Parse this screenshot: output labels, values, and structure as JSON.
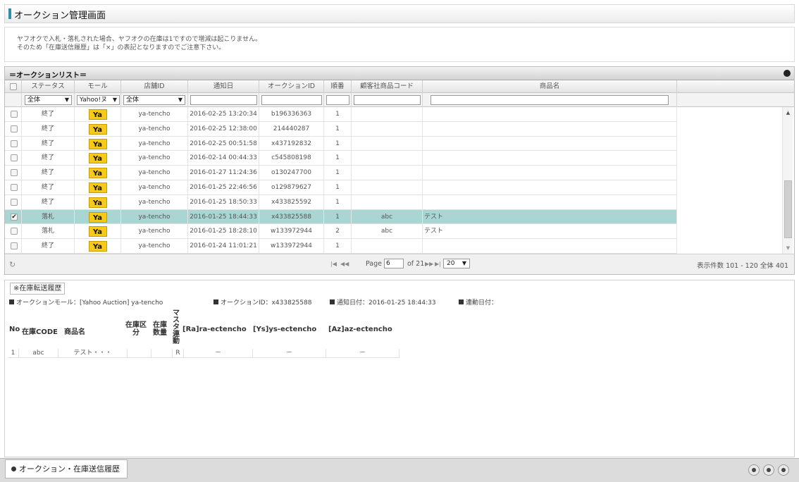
{
  "page": {
    "title": "オークション管理画面"
  },
  "notice": {
    "line1": "ヤフオクで入札・落札された場合、ヤフオクの在庫は1ですので増減は起こりません。",
    "line2": "そのため「在庫送信履歴」は「×」の表記となりますのでご注意下さい。"
  },
  "list": {
    "title": "＝オークションリスト＝",
    "columns": [
      "ステータス",
      "モール",
      "店舗ID",
      "通知日",
      "オークションID",
      "順番",
      "顧客社商品コード",
      "商品名"
    ],
    "filters": {
      "status": "全体",
      "mall": "Yahoo!ヌ",
      "store": "全体"
    },
    "rows": [
      {
        "checked": false,
        "status": "終了",
        "mall": "Ya",
        "store": "ya-tencho",
        "date": "2016-02-25 13:20:34",
        "auction_id": "b196336363",
        "order": "1",
        "code": "",
        "name": ""
      },
      {
        "checked": false,
        "status": "終了",
        "mall": "Ya",
        "store": "ya-tencho",
        "date": "2016-02-25 12:38:00",
        "auction_id": "214440287",
        "order": "1",
        "code": "",
        "name": ""
      },
      {
        "checked": false,
        "status": "終了",
        "mall": "Ya",
        "store": "ya-tencho",
        "date": "2016-02-25 00:51:58",
        "auction_id": "x437192832",
        "order": "1",
        "code": "",
        "name": ""
      },
      {
        "checked": false,
        "status": "終了",
        "mall": "Ya",
        "store": "ya-tencho",
        "date": "2016-02-14 00:44:33",
        "auction_id": "c545808198",
        "order": "1",
        "code": "",
        "name": ""
      },
      {
        "checked": false,
        "status": "終了",
        "mall": "Ya",
        "store": "ya-tencho",
        "date": "2016-01-27 11:24:36",
        "auction_id": "o130247700",
        "order": "1",
        "code": "",
        "name": ""
      },
      {
        "checked": false,
        "status": "終了",
        "mall": "Ya",
        "store": "ya-tencho",
        "date": "2016-01-25 22:46:56",
        "auction_id": "o129879627",
        "order": "1",
        "code": "",
        "name": ""
      },
      {
        "checked": false,
        "status": "終了",
        "mall": "Ya",
        "store": "ya-tencho",
        "date": "2016-01-25 18:50:33",
        "auction_id": "x433825592",
        "order": "1",
        "code": "",
        "name": ""
      },
      {
        "checked": true,
        "status": "落札",
        "mall": "Ya",
        "store": "ya-tencho",
        "date": "2016-01-25 18:44:33",
        "auction_id": "x433825588",
        "order": "1",
        "code": "abc",
        "name": "テスト"
      },
      {
        "checked": false,
        "status": "落札",
        "mall": "Ya",
        "store": "ya-tencho",
        "date": "2016-01-25 18:28:10",
        "auction_id": "w133972944",
        "order": "2",
        "code": "abc",
        "name": "テスト"
      },
      {
        "checked": false,
        "status": "終了",
        "mall": "Ya",
        "store": "ya-tencho",
        "date": "2016-01-24 11:01:21",
        "auction_id": "w133972944",
        "order": "1",
        "code": "",
        "name": ""
      }
    ],
    "pager": {
      "page_label": "Page",
      "page": "6",
      "of_label": "of 21",
      "rows_per_page": "20",
      "count_text": "表示件数 101 - 120 全体 401"
    }
  },
  "detail": {
    "legend": "※在庫転送履歴",
    "info": {
      "mall": "オークションモール：[Yahoo Auction] ya-tencho",
      "auction": "オークションID：x433825588",
      "notify": "通知日付：2016-01-25 18:44:33",
      "linked": "連動日付："
    },
    "headers": {
      "no": "No",
      "code": "在庫CODE",
      "name": "商品名",
      "kubun": "在庫区分",
      "qty": "在庫数量",
      "master": "マスタ連動",
      "ra": "[Ra]ra-ectencho",
      "ys": "[Ys]ys-ectencho",
      "az": "[Az]az-ectencho"
    },
    "rows": [
      {
        "no": "1",
        "code": "abc",
        "name": "テスト・・・",
        "kubun": "",
        "qty": "",
        "master": "R",
        "ra": "－",
        "ys": "－",
        "az": "－"
      }
    ]
  },
  "bottom": {
    "tab_label": "オークション・在庫送信履歴"
  }
}
